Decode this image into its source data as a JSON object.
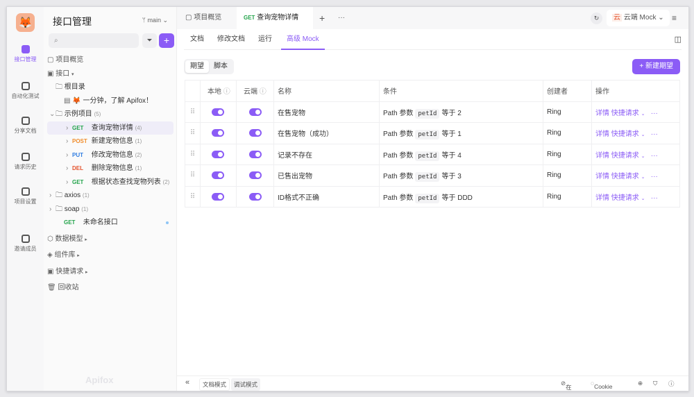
{
  "rail": {
    "items": [
      {
        "label": "接口管理",
        "icon": "api-icon",
        "active": true
      },
      {
        "label": "自动化测试",
        "icon": "test-icon"
      },
      {
        "label": "分享文档",
        "icon": "share-doc-icon"
      },
      {
        "label": "请求历史",
        "icon": "history-icon"
      },
      {
        "label": "项目设置",
        "icon": "settings-icon"
      },
      {
        "label": "邀请成员",
        "icon": "invite-user-icon"
      }
    ]
  },
  "sidebar": {
    "title": "接口管理",
    "branch": "main",
    "tree": [
      {
        "label": "项目概览",
        "level": 0,
        "icon": "overview-icon"
      },
      {
        "label": "接口",
        "level": 0,
        "icon": "api-icon",
        "caret": "▾"
      },
      {
        "label": "根目录",
        "level": 1,
        "icon": "folder-icon"
      },
      {
        "label": "🦊 一分钟，了解 Apifox！",
        "level": 2,
        "icon": "doc-icon"
      },
      {
        "label": "示例项目",
        "level": 1,
        "icon": "folder-icon",
        "count": "(5)",
        "arrow": "⌄"
      },
      {
        "method": "GET",
        "label": "查询宠物详情",
        "count": "(4)",
        "level": 2,
        "arrow": "›",
        "selected": true
      },
      {
        "method": "POST",
        "label": "新建宠物信息",
        "count": "(1)",
        "level": 2,
        "arrow": "›"
      },
      {
        "method": "PUT",
        "label": "修改宠物信息",
        "count": "(2)",
        "level": 2,
        "arrow": "›"
      },
      {
        "method": "DEL",
        "label": "删除宠物信息",
        "count": "(1)",
        "level": 2,
        "arrow": "›"
      },
      {
        "method": "GET",
        "label": "根据状态查找宠物列表",
        "count": "(2)",
        "level": 2,
        "arrow": "›"
      },
      {
        "label": "axios",
        "level": 1,
        "icon": "folder-icon",
        "count": "(1)",
        "arrow": "›"
      },
      {
        "label": "soap",
        "level": 1,
        "icon": "folder-icon",
        "count": "(1)",
        "arrow": "›"
      },
      {
        "method": "GET",
        "label": "未命名接口",
        "level": 1,
        "dot": true
      },
      {
        "label": "数据模型",
        "level": 0,
        "icon": "data-model-icon",
        "caret": "▸"
      },
      {
        "label": "组件库",
        "level": 0,
        "icon": "components-icon",
        "caret": "▸"
      },
      {
        "label": "快捷请求",
        "level": 0,
        "icon": "quick-request-icon",
        "caret": "▸"
      },
      {
        "label": "回收站",
        "level": 0,
        "icon": "trash-icon"
      }
    ],
    "watermark": "Apifox"
  },
  "methodColors": {
    "GET": "#22a34a",
    "POST": "#f08c2a",
    "PUT": "#2f7de1",
    "DEL": "#e5532d"
  },
  "tabs": {
    "overview": "项目概览",
    "active_method": "GET",
    "active": "查询宠物详情",
    "env": "云端 Mock"
  },
  "subtabs": [
    "文档",
    "修改文档",
    "运行",
    "高级 Mock"
  ],
  "segment": [
    "期望",
    "脚本"
  ],
  "new_button": "+ 新建期望",
  "table": {
    "headers": [
      "本地",
      "云端",
      "名称",
      "条件",
      "创建者",
      "操作"
    ],
    "rows": [
      {
        "local": true,
        "cloud": true,
        "name": "在售宠物",
        "param": "Path 参数",
        "key": "petId",
        "op": "等于 2",
        "creator": "Ring"
      },
      {
        "local": true,
        "cloud": true,
        "name": "在售宠物（成功）",
        "param": "Path 参数",
        "key": "petId",
        "op": "等于 1",
        "creator": "Ring"
      },
      {
        "local": true,
        "cloud": true,
        "name": "记录不存在",
        "param": "Path 参数",
        "key": "petId",
        "op": "等于 4",
        "creator": "Ring"
      },
      {
        "local": true,
        "cloud": true,
        "name": "已售出宠物",
        "param": "Path 参数",
        "key": "petId",
        "op": "等于 3",
        "creator": "Ring"
      },
      {
        "local": true,
        "cloud": true,
        "name": "ID格式不正确",
        "param": "Path 参数",
        "key": "petId",
        "op": "等于 DDD",
        "creator": "Ring"
      }
    ],
    "actions": {
      "detail": "详情",
      "quick": "快捷请求"
    }
  },
  "footer": {
    "doc_mode": "文档模式",
    "debug_mode": "调试模式",
    "online": "在线",
    "cookie": "Cookie 管理"
  },
  "accent": "#8b5cf6"
}
